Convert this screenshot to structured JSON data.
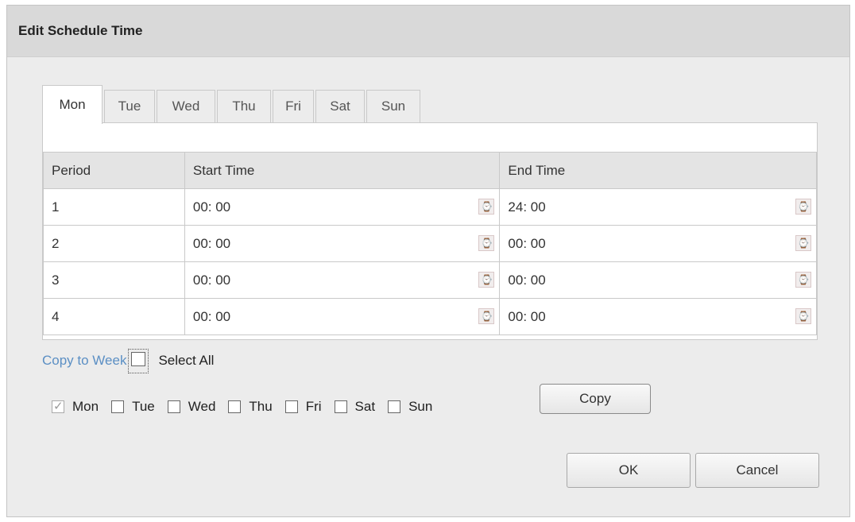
{
  "dialog": {
    "title": "Edit Schedule Time"
  },
  "tabs": [
    {
      "label": "Mon",
      "active": true
    },
    {
      "label": "Tue",
      "active": false
    },
    {
      "label": "Wed",
      "active": false
    },
    {
      "label": "Thu",
      "active": false
    },
    {
      "label": "Fri",
      "active": false
    },
    {
      "label": "Sat",
      "active": false
    },
    {
      "label": "Sun",
      "active": false
    }
  ],
  "table": {
    "headers": {
      "period": "Period",
      "start": "Start Time",
      "end": "End Time"
    },
    "rows": [
      {
        "period": "1",
        "start": "00: 00",
        "end": "24: 00"
      },
      {
        "period": "2",
        "start": "00: 00",
        "end": "00: 00"
      },
      {
        "period": "3",
        "start": "00: 00",
        "end": "00: 00"
      },
      {
        "period": "4",
        "start": "00: 00",
        "end": "00: 00"
      }
    ],
    "picker_icon": "clock-icon"
  },
  "copy": {
    "link_label": "Copy to Week",
    "select_all_label": "Select All",
    "select_all_checked": false,
    "days": [
      {
        "label": "Mon",
        "checked": true
      },
      {
        "label": "Tue",
        "checked": false
      },
      {
        "label": "Wed",
        "checked": false
      },
      {
        "label": "Thu",
        "checked": false
      },
      {
        "label": "Fri",
        "checked": false
      },
      {
        "label": "Sat",
        "checked": false
      },
      {
        "label": "Sun",
        "checked": false
      }
    ],
    "button_label": "Copy"
  },
  "footer": {
    "ok_label": "OK",
    "cancel_label": "Cancel"
  },
  "colors": {
    "link": "#5b8fc4",
    "title_bar": "#d9d9d9",
    "dialog_bg": "#ececec"
  }
}
